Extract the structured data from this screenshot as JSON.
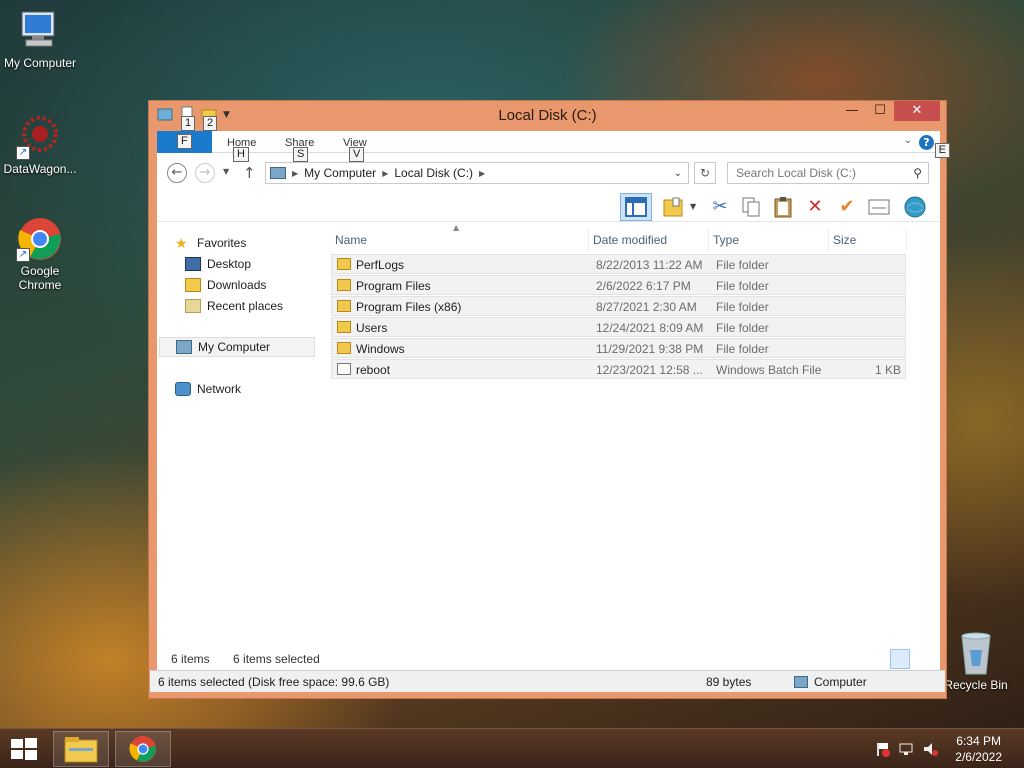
{
  "desktop": {
    "icons": [
      {
        "label": "My Computer"
      },
      {
        "label": "DataWagon..."
      },
      {
        "label": "Google Chrome"
      },
      {
        "label": "Recycle Bin"
      }
    ]
  },
  "window": {
    "title": "Local Disk (C:)",
    "qat_keytips": [
      "1",
      "2"
    ],
    "controls": {
      "minimize": "—",
      "maximize": "☐",
      "close": "✕"
    },
    "ribbon": {
      "file_keytip": "F",
      "tabs": [
        {
          "label": "Home",
          "keytip": "H"
        },
        {
          "label": "Share",
          "keytip": "S"
        },
        {
          "label": "View",
          "keytip": "V"
        }
      ],
      "help_label": "?",
      "help_keytip": "E"
    },
    "address": {
      "segments": [
        "My Computer",
        "Local Disk (C:)"
      ],
      "search_placeholder": "Search Local Disk (C:)"
    },
    "nav_pane": {
      "favorites": "Favorites",
      "desktop": "Desktop",
      "downloads": "Downloads",
      "recent": "Recent places",
      "computer": "My Computer",
      "network": "Network"
    },
    "columns": {
      "name": "Name",
      "date": "Date modified",
      "type": "Type",
      "size": "Size"
    },
    "files": [
      {
        "name": "PerfLogs",
        "date": "8/22/2013 11:22 AM",
        "type": "File folder",
        "size": ""
      },
      {
        "name": "Program Files",
        "date": "2/6/2022 6:17 PM",
        "type": "File folder",
        "size": ""
      },
      {
        "name": "Program Files (x86)",
        "date": "8/27/2021 2:30 AM",
        "type": "File folder",
        "size": ""
      },
      {
        "name": "Users",
        "date": "12/24/2021 8:09 AM",
        "type": "File folder",
        "size": ""
      },
      {
        "name": "Windows",
        "date": "11/29/2021 9:38 PM",
        "type": "File folder",
        "size": ""
      },
      {
        "name": "reboot",
        "date": "12/23/2021 12:58 ...",
        "type": "Windows Batch File",
        "size": "1 KB"
      }
    ],
    "status_items": "6 items",
    "status_selected": "6 items selected",
    "statusbar": {
      "left": "6 items selected (Disk free space: 99.6 GB)",
      "size": "89 bytes",
      "location": "Computer"
    }
  },
  "taskbar": {
    "time": "6:34 PM",
    "date": "2/6/2022"
  },
  "colors": {
    "accent": "#1979ca",
    "window_frame": "#e9986d",
    "close_button": "#c7504f"
  }
}
